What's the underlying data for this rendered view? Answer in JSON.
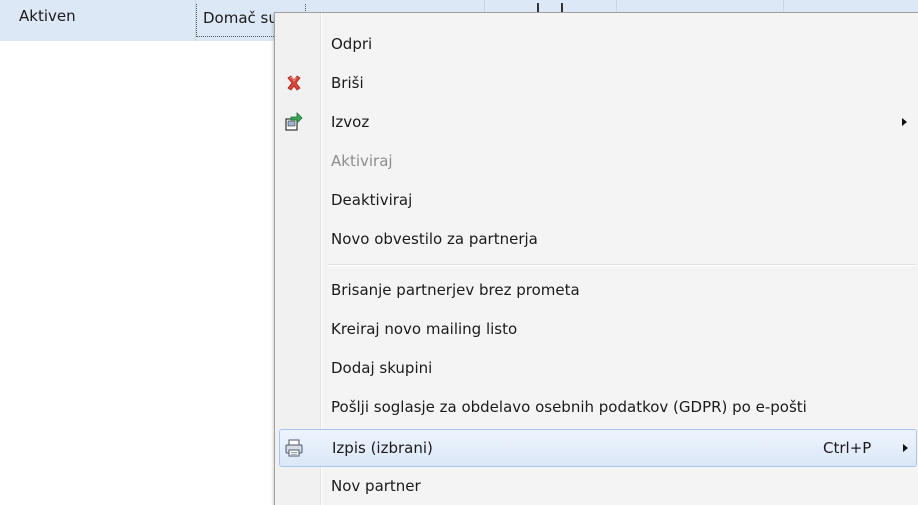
{
  "grid": {
    "row": {
      "status": "Aktiven",
      "type": "Domač su"
    }
  },
  "context_menu": {
    "items": [
      {
        "label": "Odpri",
        "icon": "",
        "enabled": true,
        "has_submenu": false
      },
      {
        "label": "Briši",
        "icon": "delete-x-icon",
        "enabled": true,
        "has_submenu": false
      },
      {
        "label": "Izvoz",
        "icon": "export-icon",
        "enabled": true,
        "has_submenu": true
      },
      {
        "label": "Aktiviraj",
        "icon": "",
        "enabled": false,
        "has_submenu": false
      },
      {
        "label": "Deaktiviraj",
        "icon": "",
        "enabled": true,
        "has_submenu": false
      },
      {
        "label": "Novo obvestilo za partnerja",
        "icon": "",
        "enabled": true,
        "has_submenu": false
      },
      {
        "label": "Brisanje partnerjev brez prometa",
        "icon": "",
        "enabled": true,
        "has_submenu": false
      },
      {
        "label": "Kreiraj novo mailing listo",
        "icon": "",
        "enabled": true,
        "has_submenu": false
      },
      {
        "label": "Dodaj skupini",
        "icon": "",
        "enabled": true,
        "has_submenu": false
      },
      {
        "label": "Pošlji soglasje za obdelavo osebnih podatkov (GDPR) po e-pošti",
        "icon": "",
        "enabled": true,
        "has_submenu": false
      },
      {
        "label": "Izpis (izbrani)",
        "icon": "printer-icon",
        "enabled": true,
        "has_submenu": true,
        "shortcut": "Ctrl+P",
        "highlighted": true
      },
      {
        "label": "Nov partner",
        "icon": "",
        "enabled": true,
        "has_submenu": false
      }
    ]
  },
  "colors": {
    "selected_row": "#dce8f6",
    "menu_background": "#f4f4f4",
    "highlight_border": "#a8c6ec",
    "disabled_text": "#8d8d8d",
    "delete_icon": "#d9443b",
    "export_icon": "#3aa655"
  }
}
